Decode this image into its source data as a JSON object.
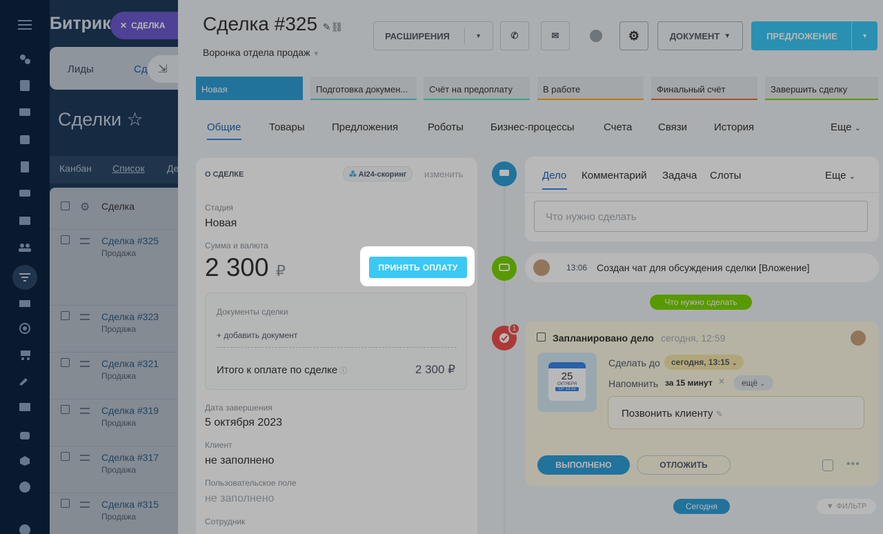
{
  "bg": {
    "logo": "Битрик",
    "chip": "СДЕЛКА",
    "tabs": [
      "Лиды",
      "Сд"
    ],
    "title": "Сделки",
    "views": [
      "Канбан",
      "Список",
      "Де"
    ],
    "list_header": "Сделка",
    "rows": [
      {
        "title": "Сделка #325",
        "sub": "Продажа"
      },
      {
        "title": "Сделка #323",
        "sub": "Продажа"
      },
      {
        "title": "Сделка #321",
        "sub": "Продажа"
      },
      {
        "title": "Сделка #319",
        "sub": "Продажа"
      },
      {
        "title": "Сделка #317",
        "sub": "Продажа"
      },
      {
        "title": "Сделка #315",
        "sub": "Продажа"
      }
    ]
  },
  "header": {
    "title": "Сделка #325",
    "funnel": "Воронка отдела продаж",
    "ext_btn": "РАСШИРЕНИЯ",
    "doc_btn": "ДОКУМЕНТ",
    "offer_btn": "ПРЕДЛОЖЕНИЕ"
  },
  "stages": [
    {
      "label": "Новая",
      "color": "#2fa0d8"
    },
    {
      "label": "Подготовка докумен...",
      "color": "#55d0e0"
    },
    {
      "label": "Счёт на предоплату",
      "color": "#47e4c2"
    },
    {
      "label": "В работе",
      "color": "#ffa900"
    },
    {
      "label": "Финальный счёт",
      "color": "#f26a3c"
    },
    {
      "label": "Завершить сделку",
      "color": "#7bd500"
    }
  ],
  "tabs": [
    "Общие",
    "Товары",
    "Предложения",
    "Роботы",
    "Бизнес-процессы",
    "Счета",
    "Связи",
    "История",
    "Еще"
  ],
  "card": {
    "header": "О СДЕЛКЕ",
    "scoring": "AI24-скоринг",
    "edit": "изменить",
    "stage_label": "Стадия",
    "stage_value": "Новая",
    "sum_label": "Сумма и валюта",
    "sum_value": "2 300",
    "currency": "₽",
    "pay_btn": "ПРИНЯТЬ ОПЛАТУ",
    "docs_label": "Документы сделки",
    "add_doc": "+ добавить документ",
    "total_label": "Итого к оплате по сделке",
    "total_value": "2 300 ₽",
    "close_label": "Дата завершения",
    "close_value": "5 октября 2023",
    "client_label": "Клиент",
    "client_value": "не заполнено",
    "custom_label": "Пользовательское поле",
    "custom_value": "не заполнено",
    "employee_label": "Сотрудник"
  },
  "activity": {
    "tabs": [
      "Дело",
      "Комментарий",
      "Задача",
      "Слоты",
      "Еще"
    ],
    "placeholder": "Что нужно сделать",
    "chat_time": "13:06",
    "chat_text": "Создан чат для обсуждения сделки [Вложение]",
    "todo_pill": "Что нужно сделать",
    "task_title": "Запланировано дело",
    "task_time": "сегодня, 12:59",
    "badge": "1",
    "do_until_label": "Сделать до",
    "do_until_value": "сегодня, 13:15",
    "remind_label": "Напомнить",
    "remind_value": "за 15 минут",
    "more": "ещё",
    "cal_day": "25",
    "cal_month": "ОКТЯБРЯ",
    "cal_time": "СР 13:15",
    "task_text": "Позвонить клиенту",
    "done_btn": "ВЫПОЛНЕНО",
    "postpone_btn": "ОТЛОЖИТЬ",
    "today_pill": "Сегодня",
    "filter": "ФИЛЬТР"
  }
}
